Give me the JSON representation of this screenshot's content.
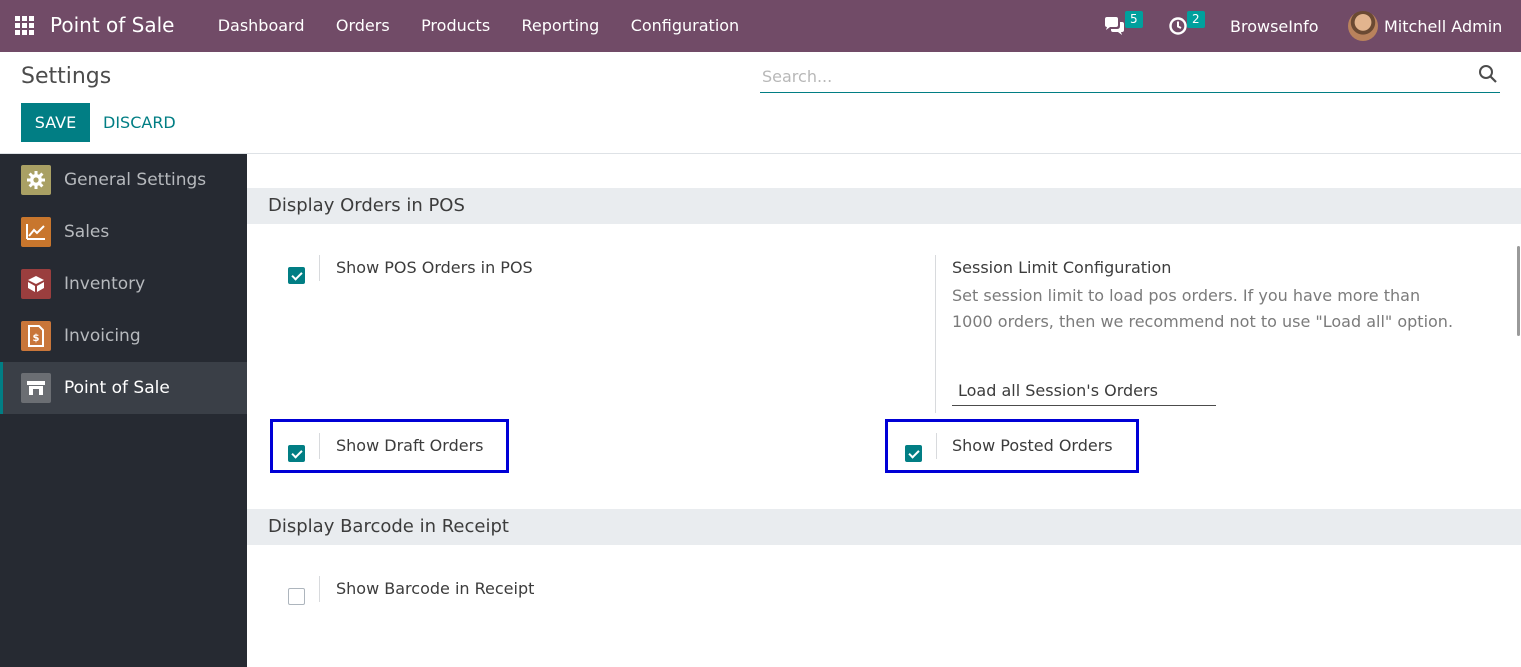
{
  "navbar": {
    "brand": "Point of Sale",
    "menu": [
      "Dashboard",
      "Orders",
      "Products",
      "Reporting",
      "Configuration"
    ],
    "messages_count": "5",
    "activities_count": "2",
    "company": "BrowseInfo",
    "user": "Mitchell Admin"
  },
  "control_panel": {
    "title": "Settings",
    "save_label": "SAVE",
    "discard_label": "DISCARD",
    "search_placeholder": "Search..."
  },
  "sidebar": {
    "items": [
      {
        "label": "General Settings",
        "icon": "gear-icon",
        "color": "#a9a064"
      },
      {
        "label": "Sales",
        "icon": "chart-icon",
        "color": "#c8762d"
      },
      {
        "label": "Inventory",
        "icon": "box-icon",
        "color": "#9a3e3e"
      },
      {
        "label": "Invoicing",
        "icon": "invoice-icon",
        "color": "#c9763a"
      },
      {
        "label": "Point of Sale",
        "icon": "store-icon",
        "color": "#6b6e73"
      }
    ],
    "active": "Point of Sale"
  },
  "sections": [
    {
      "title": "Display Orders in POS",
      "settings": [
        {
          "label": "Show POS Orders in POS",
          "checked": true
        },
        {
          "label": "Show Draft Orders",
          "checked": true,
          "highlighted": true
        },
        {
          "label": "Show Posted Orders",
          "checked": true,
          "highlighted": true
        }
      ],
      "session_limit": {
        "title": "Session Limit Configuration",
        "description": "Set session limit to load pos orders. If you have more than 1000 orders, then we recommend not to use \"Load all\" option.",
        "value": "Load all Session's Orders"
      }
    },
    {
      "title": "Display Barcode in Receipt",
      "settings": [
        {
          "label": "Show Barcode in Receipt",
          "checked": false
        }
      ]
    }
  ],
  "colors": {
    "navbar": "#714b67",
    "primary": "#017e84",
    "sidebar": "#262a32",
    "highlight": "#0000d6"
  }
}
